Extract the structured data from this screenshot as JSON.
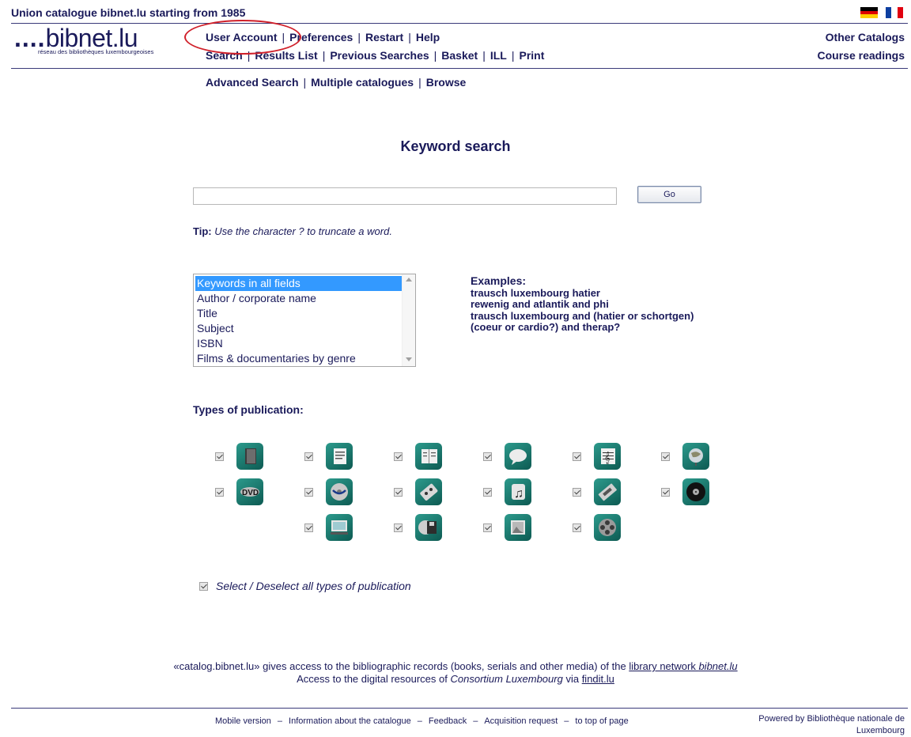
{
  "header": {
    "title": "Union catalogue bibnet.lu starting from 1985",
    "logo_text_dots": "....",
    "logo_text_name": "bibnet.lu",
    "logo_subtitle": "réseau des bibliothèques luxembourgeoises"
  },
  "nav_row1": [
    "User Account",
    "Preferences",
    "Restart",
    "Help"
  ],
  "nav_row2": [
    "Search",
    "Results List",
    "Previous Searches",
    "Basket",
    "ILL",
    "Print"
  ],
  "nav_row3": [
    "Advanced Search",
    "Multiple catalogues",
    "Browse"
  ],
  "right_links": {
    "other_catalogs": "Other Catalogs",
    "course_readings": "Course readings"
  },
  "search": {
    "heading": "Keyword search",
    "input_value": "",
    "go_label": "Go",
    "tip_label": "Tip:",
    "tip_text": " Use the character ? to truncate a word."
  },
  "search_fields": {
    "options": [
      "Keywords in all fields",
      "Author / corporate name",
      "Title",
      "Subject",
      "ISBN",
      "Films & documentaries by genre"
    ],
    "selected": "Keywords in all fields"
  },
  "examples": {
    "label": "Examples:",
    "items": [
      "trausch luxembourg hatier",
      "rewenig and atlantik and phi",
      "trausch luxembourg and (hatier or schortgen)",
      "(coeur or cardio?) and therap?"
    ]
  },
  "types": {
    "label": "Types of publication:",
    "icons": [
      "book-icon",
      "article-icon",
      "serial-icon",
      "speech-icon",
      "score-icon",
      "globe-icon",
      "dvd-icon",
      "bluray-icon",
      "audiocassette-icon",
      "music-icon",
      "videocassette-icon",
      "vinyl-icon",
      "monitor-icon",
      "floppy-icon",
      "image-icon",
      "film-reel-icon"
    ],
    "select_all": "Select / Deselect all types of publication"
  },
  "footer": {
    "line1_a": "«catalog.bibnet.lu» gives access to the bibliographic records (books, serials and other media) of the ",
    "line1_link": "library network ",
    "line1_link_i": "bibnet.lu",
    "line2_a": "Access to the digital resources of ",
    "line2_i": "Consortium Luxembourg",
    "line2_b": " via ",
    "line2_link": "findit.lu",
    "bottom_links": [
      "Mobile version",
      "Information about the catalogue",
      "Feedback",
      "Acquisition request",
      "to top of page"
    ],
    "powered_1": "Powered by Bibliothèque nationale de",
    "powered_2": "Luxembourg"
  },
  "colors": {
    "accent": "#1a1a5a",
    "highlight": "#3399ff",
    "annotation": "#d0202a",
    "icon_teal": "#1f7d72"
  }
}
